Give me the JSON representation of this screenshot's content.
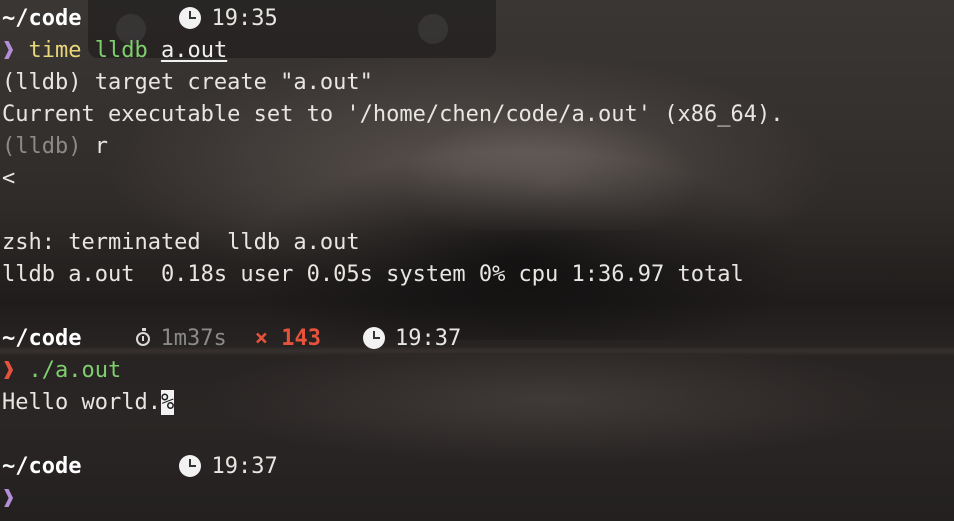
{
  "prompt1": {
    "cwd": "~/code",
    "time": "19:35",
    "symbol": "❱",
    "cmd_keyword": "time",
    "cmd_program": "lldb",
    "cmd_argument": "a.out"
  },
  "output1": {
    "target_create": "(lldb) target create \"a.out\"",
    "exec_set": "Current executable set to '/home/chen/code/a.out' (x86_64).",
    "lldb_prompt": "(lldb)",
    "lldb_cmd": " r",
    "program_out": "<",
    "blank": "",
    "terminated": "zsh: terminated  lldb a.out",
    "timing": "lldb a.out  0.18s user 0.05s system 0% cpu 1:36.97 total"
  },
  "prompt2": {
    "cwd": "~/code",
    "duration": "1m37s",
    "exit_x": "×",
    "exit_code": "143",
    "time": "19:37",
    "symbol": "❱",
    "cmd": "./a.out"
  },
  "output2": {
    "text": "Hello world.",
    "eol_marker": "%"
  },
  "prompt3": {
    "cwd": "~/code",
    "time": "19:37",
    "symbol": "❱"
  },
  "icons": {
    "clock": "clock-icon",
    "stopwatch": "stopwatch-icon"
  },
  "colors": {
    "prompt_ok": "#b48ed6",
    "prompt_err": "#e5533c",
    "keyword": "#e8d67a",
    "program": "#7fcf6e",
    "dim": "#8c8a88"
  }
}
